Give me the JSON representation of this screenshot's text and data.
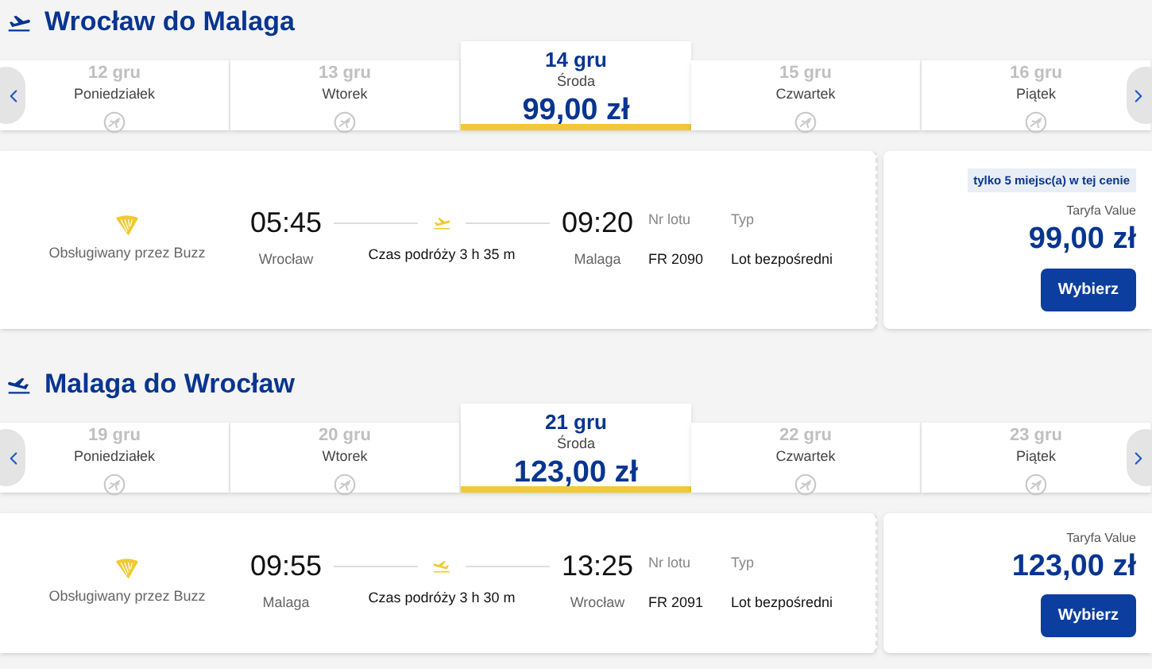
{
  "sections": [
    {
      "title": "Wrocław do Malaga",
      "kind": "departure",
      "days": [
        {
          "date": "12 gru",
          "weekday": "Poniedziałek",
          "selected": false
        },
        {
          "date": "13 gru",
          "weekday": "Wtorek",
          "selected": false
        },
        {
          "date": "14 gru",
          "weekday": "Środa",
          "price": "99,00 zł",
          "selected": true
        },
        {
          "date": "15 gru",
          "weekday": "Czwartek",
          "selected": false
        },
        {
          "date": "16 gru",
          "weekday": "Piątek",
          "selected": false
        }
      ],
      "flight": {
        "operator": "Obsługiwany przez Buzz",
        "dep_time": "05:45",
        "dep_city": "Wrocław",
        "duration": "Czas podróży 3 h 35 m",
        "arr_time": "09:20",
        "arr_city": "Malaga",
        "flight_no_label": "Nr lotu",
        "flight_no": "FR 2090",
        "type_label": "Typ",
        "type": "Lot bezpośredni",
        "badge": "tylko 5 miejsc(a) w tej cenie",
        "fare_label": "Taryfa Value",
        "price": "99,00 zł",
        "button": "Wybierz"
      }
    },
    {
      "title": "Malaga do Wrocław",
      "kind": "arrival",
      "days": [
        {
          "date": "19 gru",
          "weekday": "Poniedziałek",
          "selected": false
        },
        {
          "date": "20 gru",
          "weekday": "Wtorek",
          "selected": false
        },
        {
          "date": "21 gru",
          "weekday": "Środa",
          "price": "123,00 zł",
          "selected": true
        },
        {
          "date": "22 gru",
          "weekday": "Czwartek",
          "selected": false
        },
        {
          "date": "23 gru",
          "weekday": "Piątek",
          "selected": false
        }
      ],
      "flight": {
        "operator": "Obsługiwany przez Buzz",
        "dep_time": "09:55",
        "dep_city": "Malaga",
        "duration": "Czas podróży 3 h 30 m",
        "arr_time": "13:25",
        "arr_city": "Wrocław",
        "flight_no_label": "Nr lotu",
        "flight_no": "FR 2091",
        "type_label": "Typ",
        "type": "Lot bezpośredni",
        "fare_label": "Taryfa Value",
        "price": "123,00 zł",
        "button": "Wybierz"
      }
    }
  ]
}
